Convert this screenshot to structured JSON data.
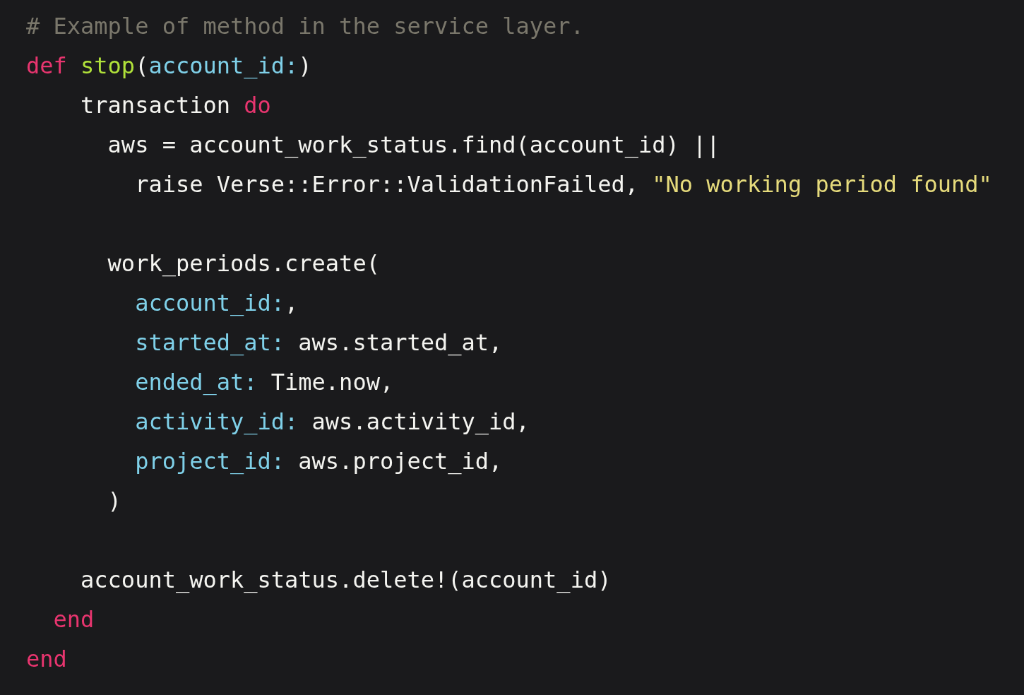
{
  "code": {
    "lines": [
      {
        "kind": "code",
        "tokens": [
          {
            "kind": "comment",
            "text": "# Example of method in the service layer."
          }
        ]
      },
      {
        "kind": "code",
        "tokens": [
          {
            "kind": "keyword",
            "text": "def "
          },
          {
            "kind": "function",
            "text": "stop"
          },
          {
            "kind": "plain",
            "text": "("
          },
          {
            "kind": "symbol",
            "text": "account_id:"
          },
          {
            "kind": "plain",
            "text": ")"
          }
        ]
      },
      {
        "kind": "code",
        "tokens": [
          {
            "kind": "plain",
            "text": "    transaction "
          },
          {
            "kind": "keyword",
            "text": "do"
          }
        ]
      },
      {
        "kind": "code",
        "tokens": [
          {
            "kind": "plain",
            "text": "      aws = account_work_status.find(account_id) ||"
          }
        ]
      },
      {
        "kind": "code",
        "tokens": [
          {
            "kind": "plain",
            "text": "        raise Verse::Error::ValidationFailed, "
          },
          {
            "kind": "string",
            "text": "\"No working period found\""
          }
        ]
      },
      {
        "kind": "blank"
      },
      {
        "kind": "code",
        "tokens": [
          {
            "kind": "plain",
            "text": "      work_periods.create("
          }
        ]
      },
      {
        "kind": "code",
        "tokens": [
          {
            "kind": "symbol",
            "text": "        account_id:"
          },
          {
            "kind": "plain",
            "text": ","
          }
        ]
      },
      {
        "kind": "code",
        "tokens": [
          {
            "kind": "symbol",
            "text": "        started_at: "
          },
          {
            "kind": "plain",
            "text": "aws.started_at,"
          }
        ]
      },
      {
        "kind": "code",
        "tokens": [
          {
            "kind": "symbol",
            "text": "        ended_at: "
          },
          {
            "kind": "plain",
            "text": "Time.now,"
          }
        ]
      },
      {
        "kind": "code",
        "tokens": [
          {
            "kind": "symbol",
            "text": "        activity_id: "
          },
          {
            "kind": "plain",
            "text": "aws.activity_id,"
          }
        ]
      },
      {
        "kind": "code",
        "tokens": [
          {
            "kind": "symbol",
            "text": "        project_id: "
          },
          {
            "kind": "plain",
            "text": "aws.project_id,"
          }
        ]
      },
      {
        "kind": "code",
        "tokens": [
          {
            "kind": "plain",
            "text": "      )"
          }
        ]
      },
      {
        "kind": "blank"
      },
      {
        "kind": "code",
        "tokens": [
          {
            "kind": "plain",
            "text": "    account_work_status.delete!(account_id)"
          }
        ]
      },
      {
        "kind": "code",
        "tokens": [
          {
            "kind": "keyword",
            "text": "  end"
          }
        ]
      },
      {
        "kind": "code",
        "tokens": [
          {
            "kind": "keyword",
            "text": "end"
          }
        ]
      }
    ]
  }
}
